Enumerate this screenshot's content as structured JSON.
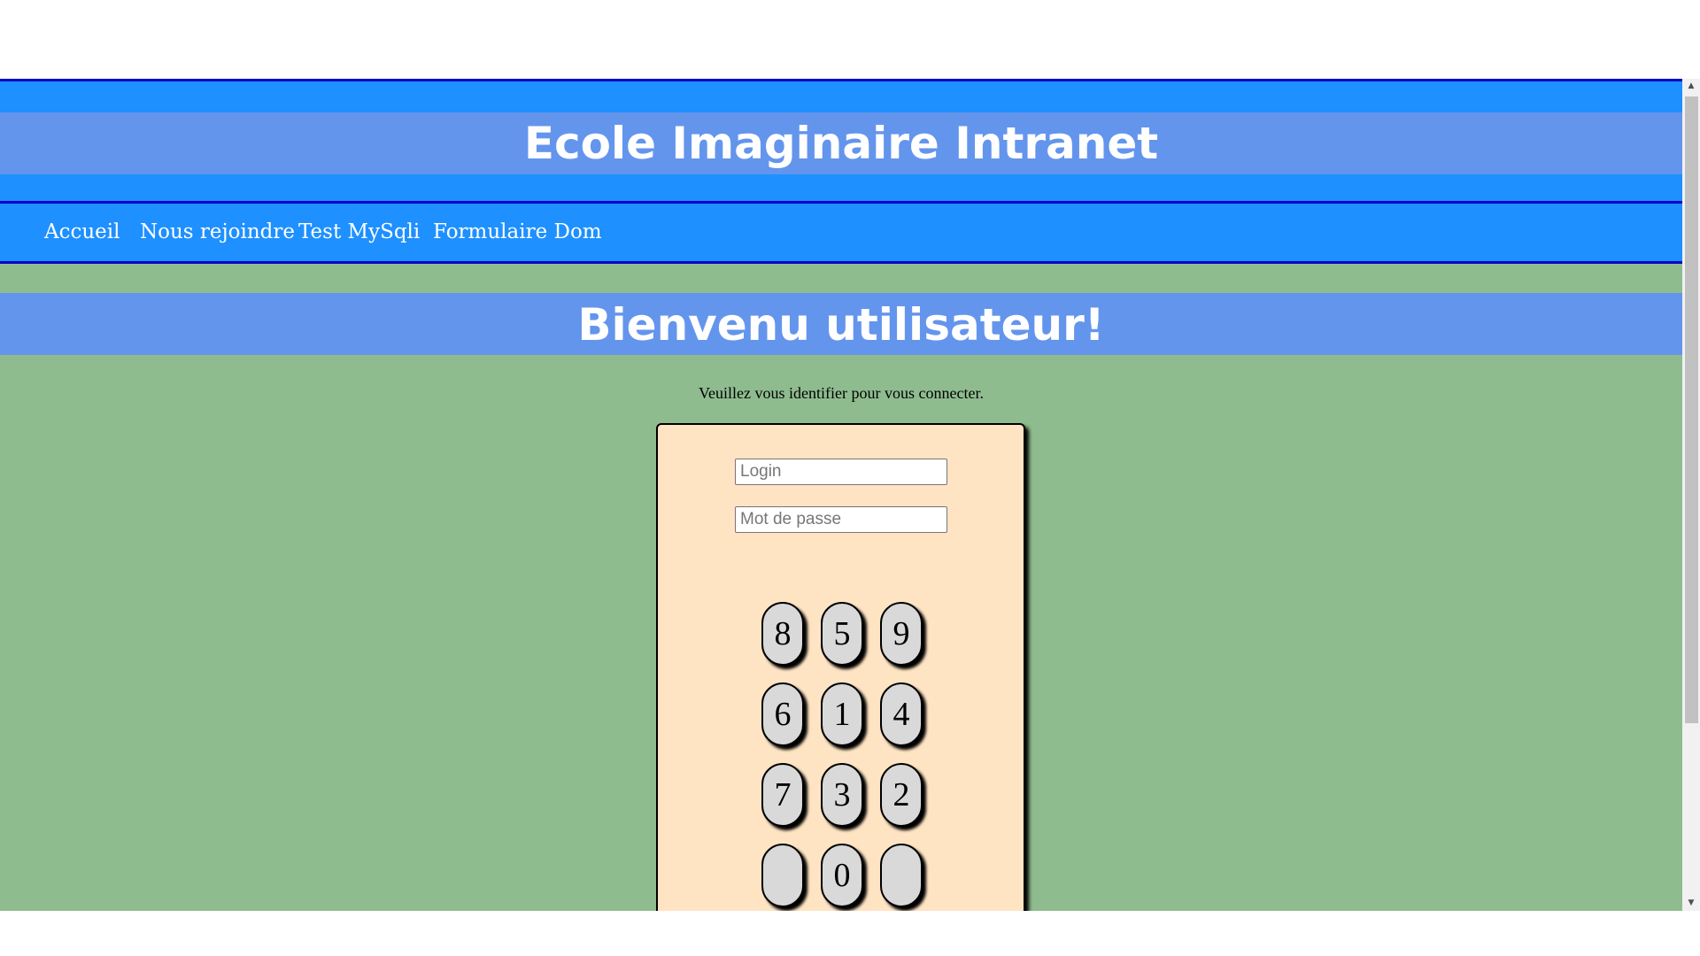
{
  "header": {
    "title": "Ecole Imaginaire Intranet"
  },
  "nav": {
    "items": [
      {
        "label": "Accueil"
      },
      {
        "label": "Nous rejoindre"
      },
      {
        "label": "Test MySqli"
      },
      {
        "label": "Formulaire Dom"
      }
    ]
  },
  "main": {
    "welcome": "Bienvenu utilisateur!",
    "instruction": "Veuillez vous identifier pour vous connecter."
  },
  "login_form": {
    "login": {
      "value": "",
      "placeholder": "Login"
    },
    "password": {
      "value": "",
      "placeholder": "Mot de passe"
    },
    "keypad": {
      "rows": [
        [
          "8",
          "5",
          "9"
        ],
        [
          "6",
          "1",
          "4"
        ],
        [
          "7",
          "3",
          "2"
        ],
        [
          "",
          "0",
          ""
        ]
      ]
    }
  },
  "scrollbar": {
    "up_icon": "arrow-up",
    "down_icon": "arrow-down"
  },
  "colors": {
    "header_blue": "#1e90ff",
    "band_blue": "#6495ed",
    "border_blue": "#0000cd",
    "page_green": "#8fbc8f",
    "form_bisque": "#ffe4c4",
    "key_gray": "#d9d9d9"
  }
}
